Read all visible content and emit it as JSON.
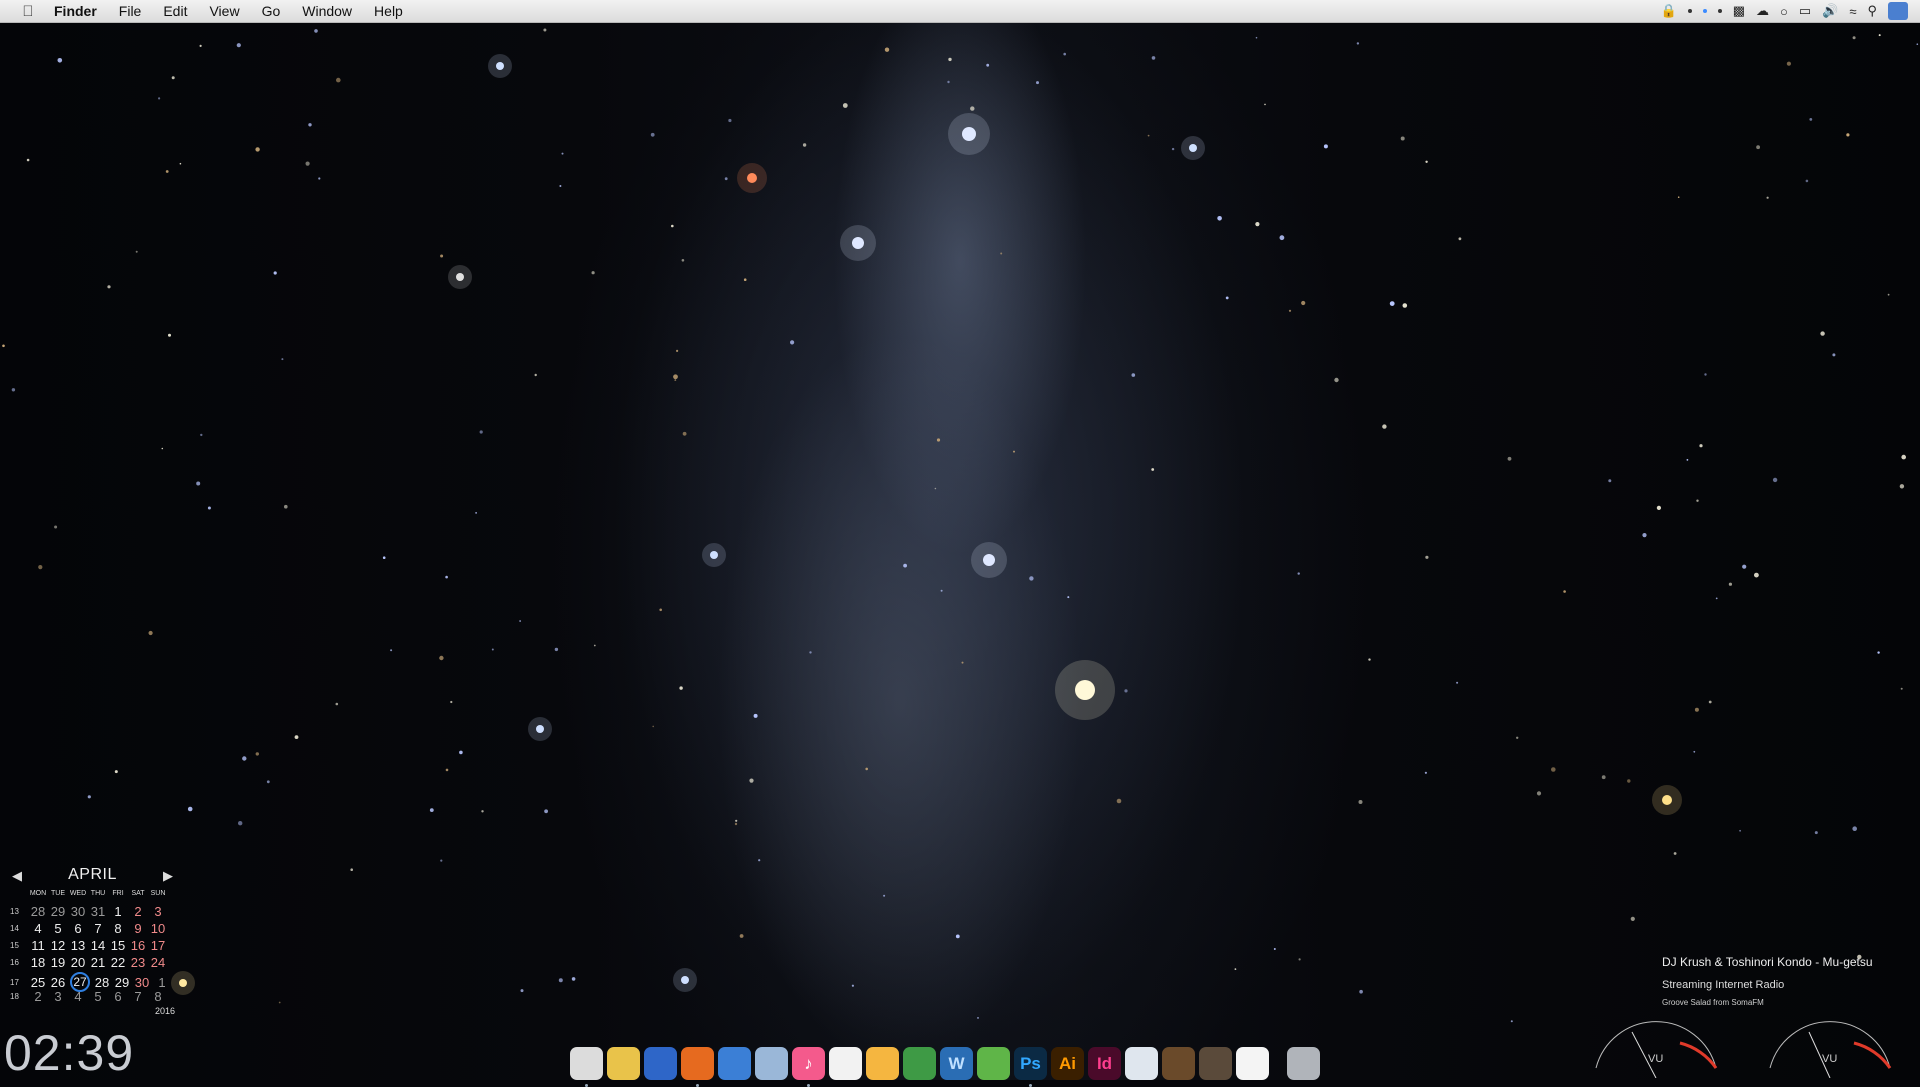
{
  "menubar": {
    "apple_icon": "apple-logo-icon",
    "items": [
      "Finder",
      "File",
      "Edit",
      "View",
      "Go",
      "Window",
      "Help"
    ],
    "status_icons": [
      "lock-icon",
      "dot-icon",
      "dot-icon",
      "dot-icon",
      "terminal-icon",
      "cloud-icon",
      "circle-icon",
      "airplay-icon",
      "volume-icon",
      "wifi-icon",
      "spotlight-icon",
      "user-icon"
    ]
  },
  "calendar": {
    "month": "APRIL",
    "year": "2016",
    "day_headers": [
      "MON",
      "TUE",
      "WED",
      "THU",
      "FRI",
      "SAT",
      "SUN"
    ],
    "weeks": [
      {
        "num": "13",
        "days": [
          "28",
          "29",
          "30",
          "31",
          "1",
          "2",
          "3"
        ]
      },
      {
        "num": "14",
        "days": [
          "4",
          "5",
          "6",
          "7",
          "8",
          "9",
          "10"
        ]
      },
      {
        "num": "15",
        "days": [
          "11",
          "12",
          "13",
          "14",
          "15",
          "16",
          "17"
        ]
      },
      {
        "num": "16",
        "days": [
          "18",
          "19",
          "20",
          "21",
          "22",
          "23",
          "24"
        ]
      },
      {
        "num": "17",
        "days": [
          "25",
          "26",
          "27",
          "28",
          "29",
          "30",
          "1"
        ]
      },
      {
        "num": "18",
        "days": [
          "2",
          "3",
          "4",
          "5",
          "6",
          "7",
          "8"
        ]
      }
    ],
    "today": "27"
  },
  "clock": {
    "time": "02:39"
  },
  "now_playing": {
    "title": "DJ Krush & Toshinori Kondo - Mu-getsu",
    "subtitle": "Streaming Internet Radio",
    "station": "Groove Salad from SomaFM",
    "vu_left": "VU",
    "vu_right": "VU"
  },
  "dock": {
    "apps": [
      {
        "name": "stormtrooper-app-icon",
        "label": "",
        "bg": "#dcdcdc",
        "color": "#111"
      },
      {
        "name": "color-picker-app-icon",
        "label": "",
        "bg": "#e9c34a",
        "color": "#111"
      },
      {
        "name": "earth-app-icon",
        "label": "",
        "bg": "#2e66c8",
        "color": "#fff"
      },
      {
        "name": "firefox-icon",
        "label": "",
        "bg": "#e66a1f",
        "color": "#fff"
      },
      {
        "name": "safari-icon",
        "label": "",
        "bg": "#3b7fd6",
        "color": "#fff"
      },
      {
        "name": "preview-icon",
        "label": "",
        "bg": "#9ab7d8",
        "color": "#fff"
      },
      {
        "name": "itunes-icon",
        "label": "♪",
        "bg": "#f45a8c",
        "color": "#fff"
      },
      {
        "name": "textedit-icon",
        "label": "",
        "bg": "#f2f2f2",
        "color": "#333"
      },
      {
        "name": "pages-icon",
        "label": "",
        "bg": "#f5b640",
        "color": "#fff"
      },
      {
        "name": "numbers-icon",
        "label": "",
        "bg": "#3e9a45",
        "color": "#fff"
      },
      {
        "name": "wunderlist-icon",
        "label": "W",
        "bg": "#2a6db4",
        "color": "#bfe0ff"
      },
      {
        "name": "plant-app-icon",
        "label": "",
        "bg": "#5fb548",
        "color": "#fff"
      },
      {
        "name": "photoshop-icon",
        "label": "Ps",
        "bg": "#0b2a44",
        "color": "#31a8ff"
      },
      {
        "name": "illustrator-icon",
        "label": "Ai",
        "bg": "#3a1f00",
        "color": "#ff9a00"
      },
      {
        "name": "indesign-icon",
        "label": "Id",
        "bg": "#4a0a2a",
        "color": "#ff3d8e"
      },
      {
        "name": "finder-window-icon",
        "label": "",
        "bg": "#dfe6ee",
        "color": "#333"
      },
      {
        "name": "minecraft-icon",
        "label": "",
        "bg": "#6a4a2a",
        "color": "#6bbf3f"
      },
      {
        "name": "archive-app-icon",
        "label": "",
        "bg": "#5a4a3a",
        "color": "#fff"
      },
      {
        "name": "clock-app-icon",
        "label": "",
        "bg": "#f4f4f4",
        "color": "#333"
      },
      {
        "name": "trash-icon",
        "label": "",
        "bg": "#b0b4ba",
        "color": "#333"
      }
    ]
  }
}
